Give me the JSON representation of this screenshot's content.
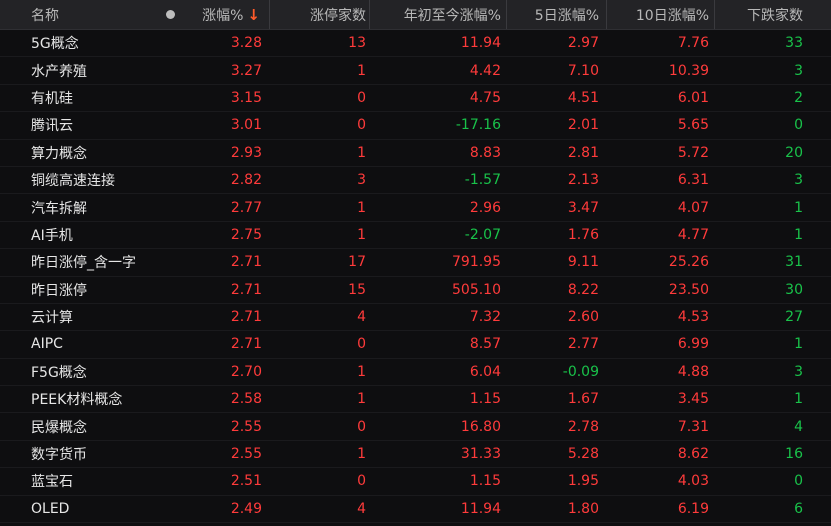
{
  "header": {
    "name": "名称",
    "change_pct": "涨幅%",
    "limit_up_count": "涨停家数",
    "ytd_change": "年初至今涨幅%",
    "d5_change": "5日涨幅%",
    "d10_change": "10日涨幅%",
    "decline_count": "下跌家数",
    "sort_icon": "arrow-down-icon"
  },
  "rows": [
    {
      "name": "5G概念",
      "chg": "3.28",
      "lim": "13",
      "ytd": "11.94",
      "d5": "2.97",
      "d10": "7.76",
      "down": "33",
      "lim_dir": "up",
      "ytd_dir": "up",
      "d5_dir": "up",
      "d10_dir": "up"
    },
    {
      "name": "水产养殖",
      "chg": "3.27",
      "lim": "1",
      "ytd": "4.42",
      "d5": "7.10",
      "d10": "10.39",
      "down": "3",
      "lim_dir": "up",
      "ytd_dir": "up",
      "d5_dir": "up",
      "d10_dir": "up"
    },
    {
      "name": "有机硅",
      "chg": "3.15",
      "lim": "0",
      "ytd": "4.75",
      "d5": "4.51",
      "d10": "6.01",
      "down": "2",
      "lim_dir": "up",
      "ytd_dir": "up",
      "d5_dir": "up",
      "d10_dir": "up"
    },
    {
      "name": "腾讯云",
      "chg": "3.01",
      "lim": "0",
      "ytd": "-17.16",
      "d5": "2.01",
      "d10": "5.65",
      "down": "0",
      "lim_dir": "up",
      "ytd_dir": "down",
      "d5_dir": "up",
      "d10_dir": "up"
    },
    {
      "name": "算力概念",
      "chg": "2.93",
      "lim": "1",
      "ytd": "8.83",
      "d5": "2.81",
      "d10": "5.72",
      "down": "20",
      "lim_dir": "up",
      "ytd_dir": "up",
      "d5_dir": "up",
      "d10_dir": "up"
    },
    {
      "name": "铜缆高速连接",
      "chg": "2.82",
      "lim": "3",
      "ytd": "-1.57",
      "d5": "2.13",
      "d10": "6.31",
      "down": "3",
      "lim_dir": "up",
      "ytd_dir": "down",
      "d5_dir": "up",
      "d10_dir": "up"
    },
    {
      "name": "汽车拆解",
      "chg": "2.77",
      "lim": "1",
      "ytd": "2.96",
      "d5": "3.47",
      "d10": "4.07",
      "down": "1",
      "lim_dir": "up",
      "ytd_dir": "up",
      "d5_dir": "up",
      "d10_dir": "up"
    },
    {
      "name": "AI手机",
      "chg": "2.75",
      "lim": "1",
      "ytd": "-2.07",
      "d5": "1.76",
      "d10": "4.77",
      "down": "1",
      "lim_dir": "up",
      "ytd_dir": "down",
      "d5_dir": "up",
      "d10_dir": "up"
    },
    {
      "name": "昨日涨停_含一字",
      "chg": "2.71",
      "lim": "17",
      "ytd": "791.95",
      "d5": "9.11",
      "d10": "25.26",
      "down": "31",
      "lim_dir": "up",
      "ytd_dir": "up",
      "d5_dir": "up",
      "d10_dir": "up"
    },
    {
      "name": "昨日涨停",
      "chg": "2.71",
      "lim": "15",
      "ytd": "505.10",
      "d5": "8.22",
      "d10": "23.50",
      "down": "30",
      "lim_dir": "up",
      "ytd_dir": "up",
      "d5_dir": "up",
      "d10_dir": "up"
    },
    {
      "name": "云计算",
      "chg": "2.71",
      "lim": "4",
      "ytd": "7.32",
      "d5": "2.60",
      "d10": "4.53",
      "down": "27",
      "lim_dir": "up",
      "ytd_dir": "up",
      "d5_dir": "up",
      "d10_dir": "up"
    },
    {
      "name": "AIPC",
      "chg": "2.71",
      "lim": "0",
      "ytd": "8.57",
      "d5": "2.77",
      "d10": "6.99",
      "down": "1",
      "lim_dir": "up",
      "ytd_dir": "up",
      "d5_dir": "up",
      "d10_dir": "up"
    },
    {
      "name": "F5G概念",
      "chg": "2.70",
      "lim": "1",
      "ytd": "6.04",
      "d5": "-0.09",
      "d10": "4.88",
      "down": "3",
      "lim_dir": "up",
      "ytd_dir": "up",
      "d5_dir": "down",
      "d10_dir": "up"
    },
    {
      "name": "PEEK材料概念",
      "chg": "2.58",
      "lim": "1",
      "ytd": "1.15",
      "d5": "1.67",
      "d10": "3.45",
      "down": "1",
      "lim_dir": "up",
      "ytd_dir": "up",
      "d5_dir": "up",
      "d10_dir": "up"
    },
    {
      "name": "民爆概念",
      "chg": "2.55",
      "lim": "0",
      "ytd": "16.80",
      "d5": "2.78",
      "d10": "7.31",
      "down": "4",
      "lim_dir": "up",
      "ytd_dir": "up",
      "d5_dir": "up",
      "d10_dir": "up"
    },
    {
      "name": "数字货币",
      "chg": "2.55",
      "lim": "1",
      "ytd": "31.33",
      "d5": "5.28",
      "d10": "8.62",
      "down": "16",
      "lim_dir": "up",
      "ytd_dir": "up",
      "d5_dir": "up",
      "d10_dir": "up"
    },
    {
      "name": "蓝宝石",
      "chg": "2.51",
      "lim": "0",
      "ytd": "1.15",
      "d5": "1.95",
      "d10": "4.03",
      "down": "0",
      "lim_dir": "up",
      "ytd_dir": "up",
      "d5_dir": "up",
      "d10_dir": "up"
    },
    {
      "name": "OLED",
      "chg": "2.49",
      "lim": "4",
      "ytd": "11.94",
      "d5": "1.80",
      "d10": "6.19",
      "down": "6",
      "lim_dir": "up",
      "ytd_dir": "up",
      "d5_dir": "up",
      "d10_dir": "up"
    }
  ],
  "colors": {
    "up": "#ff3b3b",
    "down": "#19c24a",
    "background": "#0e0e10",
    "header_bg": "#232326",
    "sort_arrow": "#ff5a2a"
  }
}
